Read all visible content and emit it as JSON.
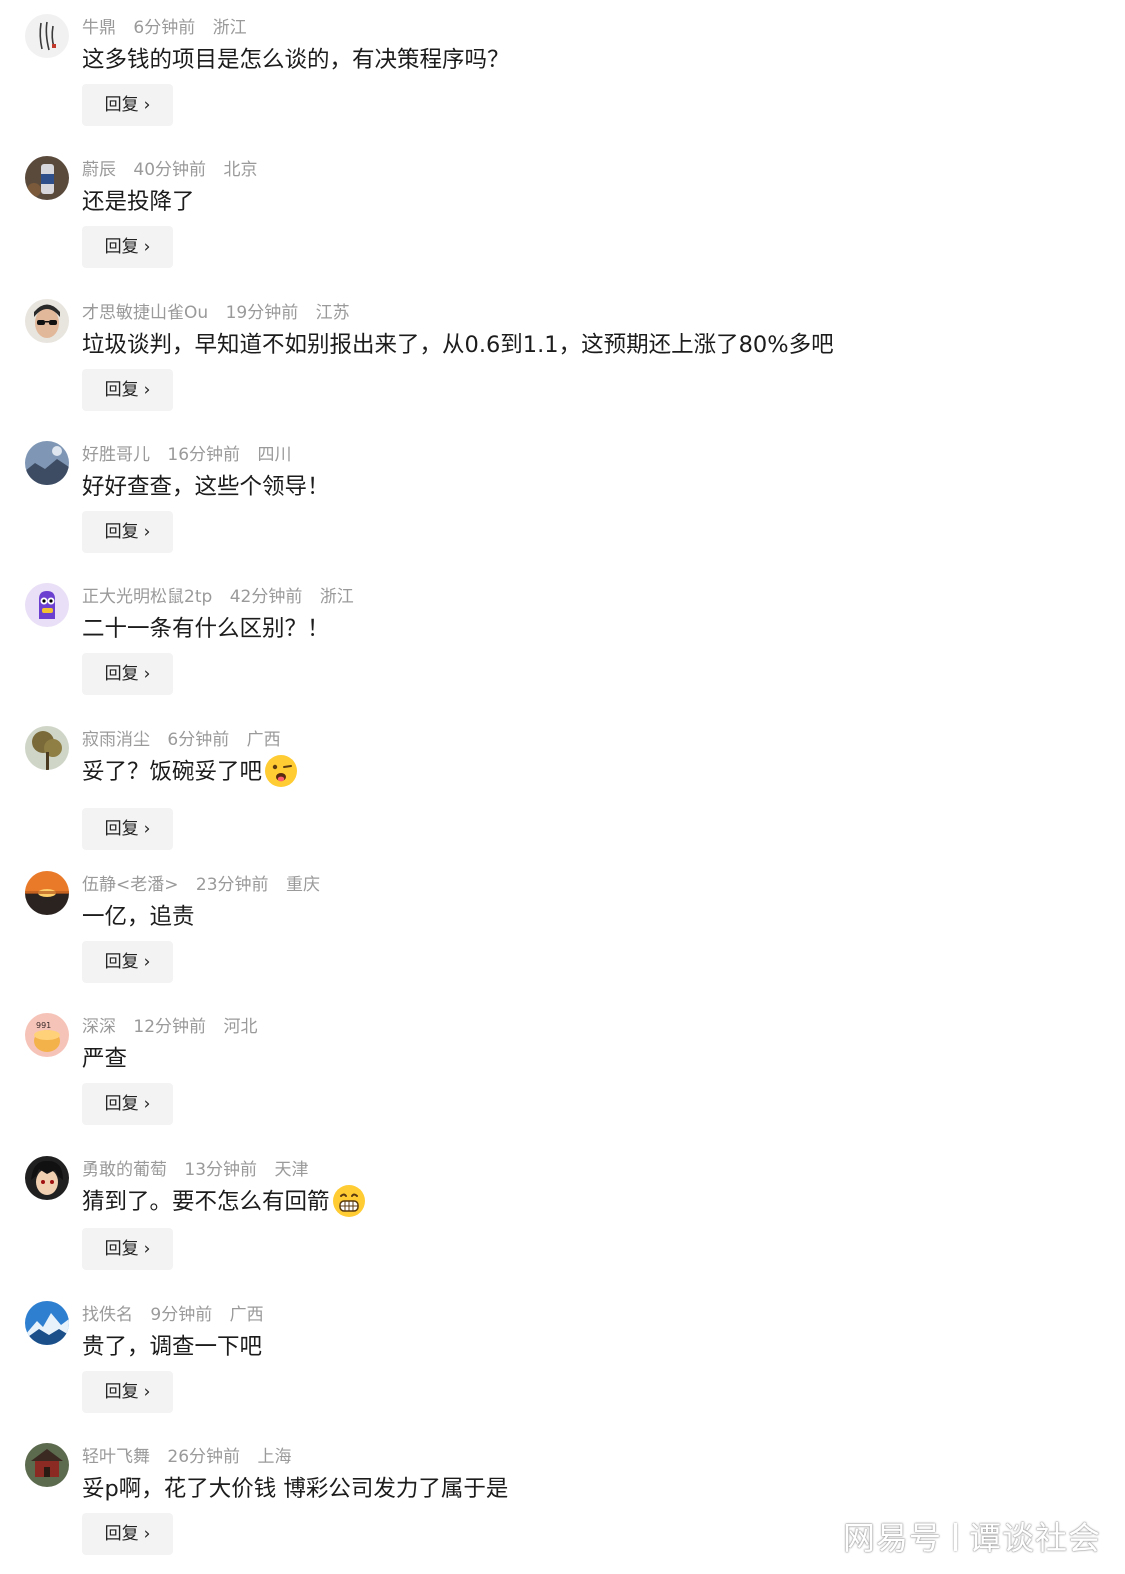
{
  "reply_label": "回复",
  "comments": [
    {
      "user": "牛鼎",
      "time": "6分钟前",
      "location": "浙江",
      "text": "这多钱的项目是怎么谈的，有决策程序吗？"
    },
    {
      "user": "蔚辰",
      "time": "40分钟前",
      "location": "北京",
      "text": "还是投降了"
    },
    {
      "user": "才思敏捷山雀Ou",
      "time": "19分钟前",
      "location": "江苏",
      "text": "垃圾谈判，早知道不如别报出来了，从0.6到1.1，这预期还上涨了80%多吧"
    },
    {
      "user": "好胜哥儿",
      "time": "16分钟前",
      "location": "四川",
      "text": "好好查查，这些个领导！"
    },
    {
      "user": "正大光明松鼠2tp",
      "time": "42分钟前",
      "location": "浙江",
      "text": "二十一条有什么区别？！"
    },
    {
      "user": "寂雨消尘",
      "time": "6分钟前",
      "location": "广西",
      "text": "妥了？饭碗妥了吧"
    },
    {
      "user": "伍静<老潘>",
      "time": "23分钟前",
      "location": "重庆",
      "text": "一亿，追责"
    },
    {
      "user": "深深",
      "time": "12分钟前",
      "location": "河北",
      "text": "严查"
    },
    {
      "user": "勇敢的葡萄",
      "time": "13分钟前",
      "location": "天津",
      "text": "猜到了。要不怎么有回箭"
    },
    {
      "user": "找佚名",
      "time": "9分钟前",
      "location": "广西",
      "text": "贵了，调查一下吧"
    },
    {
      "user": "轻叶飞舞",
      "time": "26分钟前",
      "location": "上海",
      "text": "妥p啊，花了大价钱 博彩公司发力了属于是"
    }
  ],
  "watermark": {
    "platform": "网易号",
    "account": "谭谈社会"
  }
}
